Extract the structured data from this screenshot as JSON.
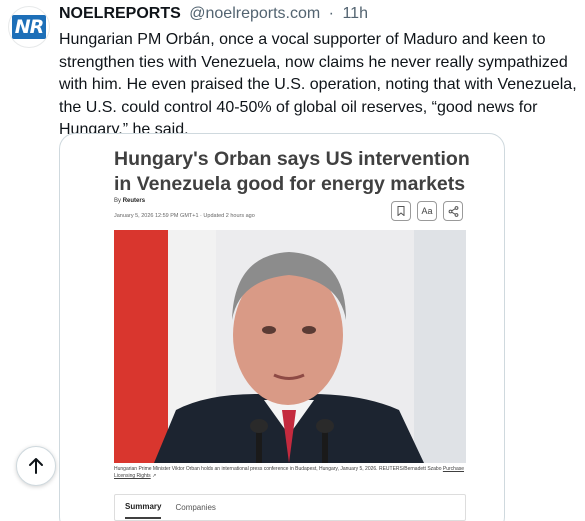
{
  "tweet": {
    "avatar_text": "NR",
    "display_name": "NOELREPORTS",
    "handle": "@noelreports.com",
    "separator": "·",
    "time": "11h",
    "text": "Hungarian PM Orbán, once a vocal supporter of Maduro and keen to strengthen ties with Venezuela, now claims he never really sympathized with him. He even praised the U.S. operation, noting that with Venezuela, the U.S. could control 40-50% of global oil reserves, “good news for Hungary,” he said."
  },
  "card": {
    "headline": "Hungary's Orban says US intervention in Venezuela good for energy markets",
    "byline_prefix": "By",
    "byline_source": "Reuters",
    "dateline": "January 5, 2026 12:59 PM GMT+1 · Updated 2 hours ago",
    "tools": {
      "bookmark_icon": "bookmark-icon",
      "text_size_label": "Aa",
      "share_icon": "share-icon"
    },
    "caption": "Hungarian Prime Minister Viktor Orban holds an international press conference in Budapest, Hungary, January 5, 2026. REUTERS/Bernadett Szabo",
    "caption_link": "Purchase Licensing Rights",
    "tabs": [
      "Summary",
      "Companies"
    ]
  },
  "ui": {
    "scroll_top_icon": "arrow-up-icon"
  },
  "colors": {
    "name": "#0f1419",
    "muted": "#536471",
    "border": "#cfd9de",
    "avatar_brand": "#1d6fb8"
  }
}
